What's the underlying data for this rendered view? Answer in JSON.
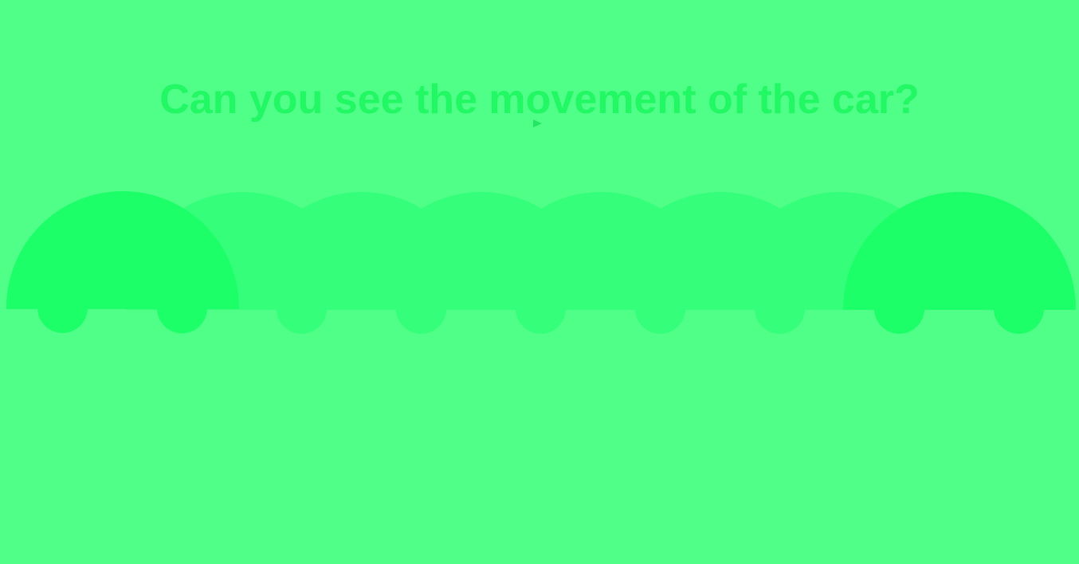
{
  "heading": "Can you see the movement of the car?",
  "colors": {
    "background": "#50ff88",
    "heading": "#22f764",
    "car_solid": "#1dff68",
    "car_ghost": "#35ff7a"
  },
  "icons": {
    "cursor": "mouse-pointer-icon"
  }
}
